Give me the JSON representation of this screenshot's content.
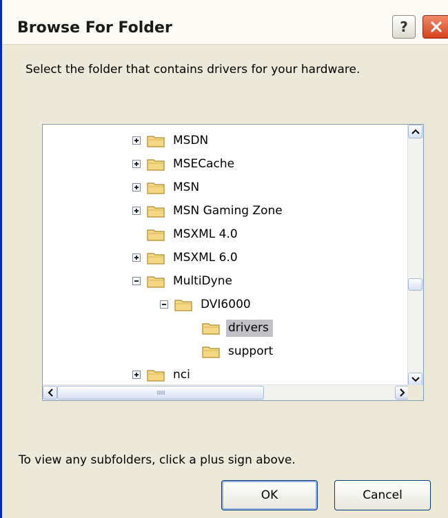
{
  "window": {
    "title": "Browse For Folder",
    "help_label": "?"
  },
  "instruction": "Select the folder that contains drivers for your hardware.",
  "tree": {
    "items": [
      {
        "label": "MSDN",
        "expander": "plus",
        "level": 0,
        "selected": false
      },
      {
        "label": "MSECache",
        "expander": "plus",
        "level": 0,
        "selected": false
      },
      {
        "label": "MSN",
        "expander": "plus",
        "level": 0,
        "selected": false
      },
      {
        "label": "MSN Gaming Zone",
        "expander": "plus",
        "level": 0,
        "selected": false
      },
      {
        "label": "MSXML 4.0",
        "expander": "none",
        "level": 0,
        "selected": false
      },
      {
        "label": "MSXML 6.0",
        "expander": "plus",
        "level": 0,
        "selected": false
      },
      {
        "label": "MultiDyne",
        "expander": "minus",
        "level": 0,
        "selected": false
      },
      {
        "label": "DVI6000",
        "expander": "minus",
        "level": 1,
        "selected": false
      },
      {
        "label": "drivers",
        "expander": "none",
        "level": 2,
        "selected": true
      },
      {
        "label": "support",
        "expander": "none",
        "level": 2,
        "selected": false
      },
      {
        "label": "nci",
        "expander": "plus",
        "level": 0,
        "selected": false
      }
    ],
    "vertical_scroll_position": 0.63,
    "horizontal_scroll_position": 0.0
  },
  "hint": "To view any subfolders, click a plus sign above.",
  "buttons": {
    "ok": "OK",
    "cancel": "Cancel"
  },
  "icons": {
    "help": "help-icon",
    "close": "close-icon",
    "folder": "folder-icon",
    "expand": "plus-box-icon",
    "collapse": "minus-box-icon"
  },
  "colors": {
    "dialog_background": "#ece9d8",
    "close_button": "#d6431c",
    "selection": "#c1c1c8",
    "folder": "#f5d784"
  }
}
